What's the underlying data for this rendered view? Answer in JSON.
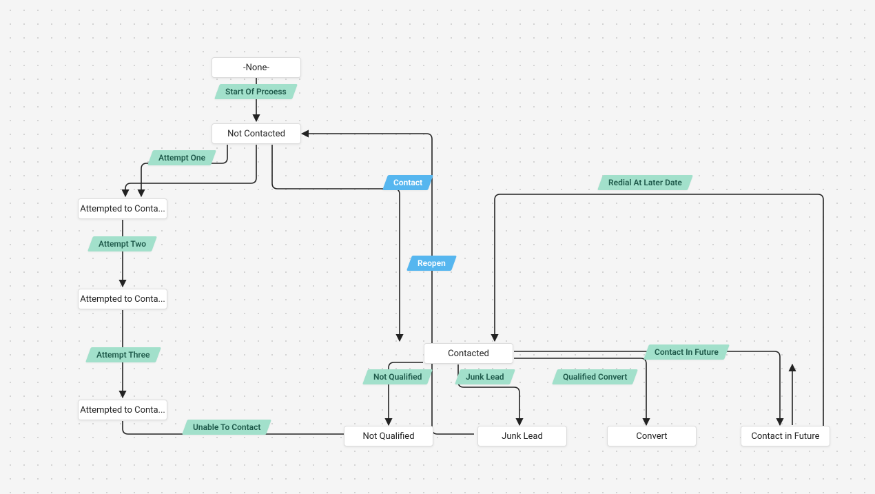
{
  "nodes": {
    "none": "-None-",
    "not_contacted": "Not Contacted",
    "attempt1": "Attempted to Conta...",
    "attempt2": "Attempted to Conta...",
    "attempt3": "Attempted to Conta...",
    "contacted": "Contacted",
    "not_qualified": "Not Qualified",
    "junk_lead": "Junk Lead",
    "convert": "Convert",
    "contact_future": "Contact in Future"
  },
  "tags": {
    "start": "Start Of Prcoess",
    "attempt_one": "Attempt One",
    "attempt_two": "Attempt Two",
    "attempt_three": "Attempt Three",
    "unable": "Unable To Contact",
    "contact": "Contact",
    "reopen": "Reopen",
    "redial": "Redial At Later Date",
    "not_qualified": "Not Qualified",
    "junk_lead": "Junk Lead",
    "qualified": "Qualified Convert",
    "contact_future": "Contact In Future"
  },
  "colors": {
    "tag_green": "#a2e0cb",
    "tag_blue": "#56b6ef"
  }
}
